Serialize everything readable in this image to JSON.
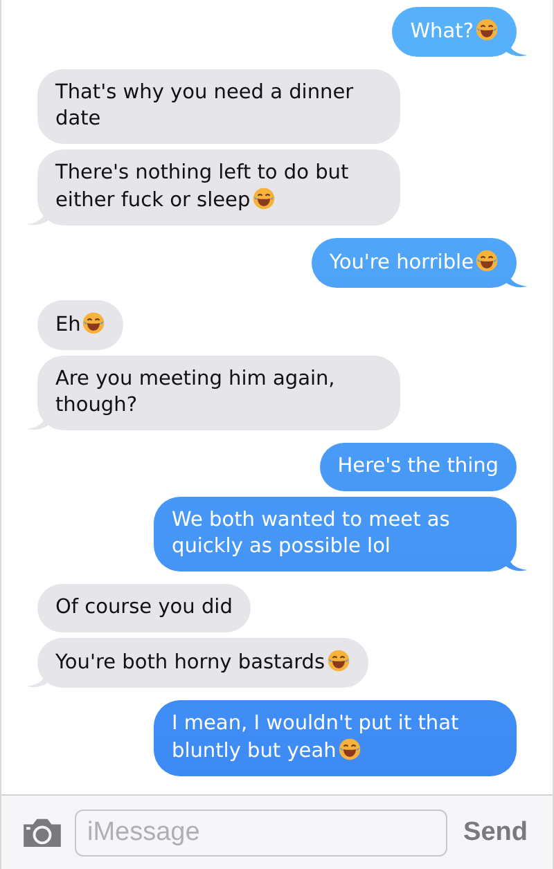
{
  "messages": [
    {
      "kind": "sent",
      "text": "What?",
      "emoji": true,
      "tail": true
    },
    {
      "kind": "received",
      "text": "That's why you need a dinner date",
      "emoji": false,
      "tail": false
    },
    {
      "kind": "received",
      "text": "There's nothing left to do but either fuck or sleep",
      "emoji": true,
      "tail": true
    },
    {
      "kind": "sent",
      "text": "You're horrible",
      "emoji": true,
      "tail": true
    },
    {
      "kind": "received",
      "text": "Eh",
      "emoji": true,
      "tail": false
    },
    {
      "kind": "received",
      "text": "Are you meeting him again, though?",
      "emoji": false,
      "tail": true
    },
    {
      "kind": "sent",
      "text": "Here's the thing",
      "emoji": false,
      "tail": false
    },
    {
      "kind": "sent",
      "text": "We both wanted to meet as quickly as possible lol",
      "emoji": false,
      "tail": true
    },
    {
      "kind": "received",
      "text": "Of course you did",
      "emoji": false,
      "tail": false
    },
    {
      "kind": "received",
      "text": "You're both horny bastards",
      "emoji": true,
      "tail": true
    },
    {
      "kind": "sent",
      "text": "I mean, I wouldn't put it that bluntly but yeah",
      "emoji": true,
      "tail": false
    }
  ],
  "composer": {
    "placeholder": "iMessage",
    "send": "Send"
  }
}
